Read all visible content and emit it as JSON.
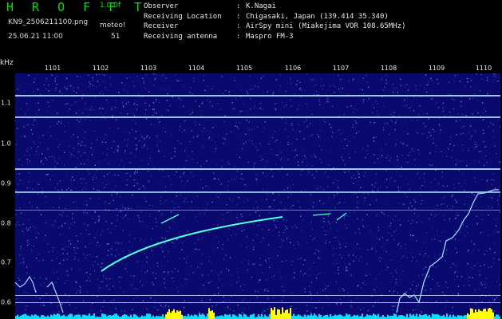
{
  "header": {
    "title": "H R O F F T",
    "version": "1.0.0f",
    "filename": "KN9_2506211100.png",
    "meteo_label": "meteo!",
    "datetime": "25.06.21 11:00",
    "count": "51"
  },
  "meta": [
    {
      "key": "Observer",
      "value": "K.Nagai"
    },
    {
      "key": "Receiving Location",
      "value": "Chigasaki, Japan (139.414 35.340)"
    },
    {
      "key": "Receiver",
      "value": "AirSpy mini (Miakejima VOR 108.65MHz)"
    },
    {
      "key": "Receiving antenna",
      "value": "Maspro FM-3"
    }
  ],
  "axes": {
    "y_unit": "kHz",
    "y_ticks": [
      "1.1",
      "1.0",
      "0.9",
      "0.8",
      "0.7",
      "0.6"
    ],
    "x_ticks": [
      "1101",
      "1102",
      "1103",
      "1104",
      "1105",
      "1106",
      "1107",
      "1108",
      "1109",
      "1110"
    ]
  },
  "colors": {
    "background": "#000000",
    "spectrogram_bg": "#0a0a6e",
    "signal": "#bfe8ff",
    "meteor": "#55ffdd",
    "baseline": "#00e0ff",
    "burst": "#ffff00",
    "title": "#00e000"
  }
}
